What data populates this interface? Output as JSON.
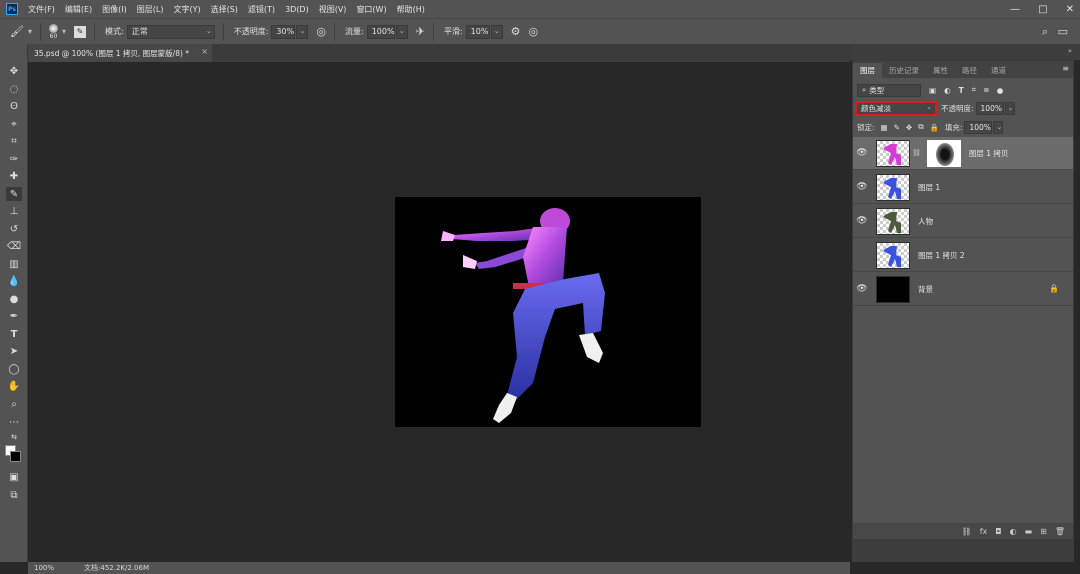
{
  "app": {
    "logo": "Ps"
  },
  "menu": [
    "文件(F)",
    "编辑(E)",
    "图像(I)",
    "图层(L)",
    "文字(Y)",
    "选择(S)",
    "滤镜(T)",
    "3D(D)",
    "视图(V)",
    "窗口(W)",
    "帮助(H)"
  ],
  "window_controls": {
    "minimize": "—",
    "maximize": "□",
    "close": "✕"
  },
  "options": {
    "brush_size": "60",
    "mode_label": "模式:",
    "mode_value": "正常",
    "opacity_label": "不透明度:",
    "opacity_value": "30%",
    "flow_label": "流量:",
    "flow_value": "100%",
    "smooth_label": "平滑:",
    "smooth_value": "10%"
  },
  "document": {
    "tab_title": "35.psd @ 100% (图层 1 拷贝, 图层蒙版/8) *",
    "close": "×"
  },
  "status": {
    "zoom": "100%",
    "doc_info": "文档:452.2K/2.06M"
  },
  "panel": {
    "tabs": [
      "图层",
      "历史记录",
      "属性",
      "路径",
      "通道"
    ],
    "active_tab": 0,
    "filter_kind": "类型",
    "blend_mode": "颜色减淡",
    "opacity_label": "不透明度:",
    "opacity_value": "100%",
    "lock_label": "锁定:",
    "fill_label": "填充:",
    "fill_value": "100%"
  },
  "layers": [
    {
      "name": "图层 1 拷贝",
      "visible": true,
      "selected": true,
      "has_mask": true,
      "tint": "#d63bd8"
    },
    {
      "name": "图层 1",
      "visible": true,
      "selected": false,
      "has_mask": false,
      "tint": "#3b52e0"
    },
    {
      "name": "人物",
      "visible": true,
      "selected": false,
      "has_mask": false,
      "tint": "#4a5a3a"
    },
    {
      "name": "图层 1 拷贝 2",
      "visible": false,
      "selected": false,
      "has_mask": false,
      "tint": "#3b52e0"
    },
    {
      "name": "背景",
      "visible": true,
      "selected": false,
      "has_mask": false,
      "locked": true,
      "tint": "#000000"
    }
  ],
  "colors": {
    "accent_highlight": "#d32020",
    "figure_purple": "#b04be0",
    "figure_blue": "#3b4fd6"
  }
}
